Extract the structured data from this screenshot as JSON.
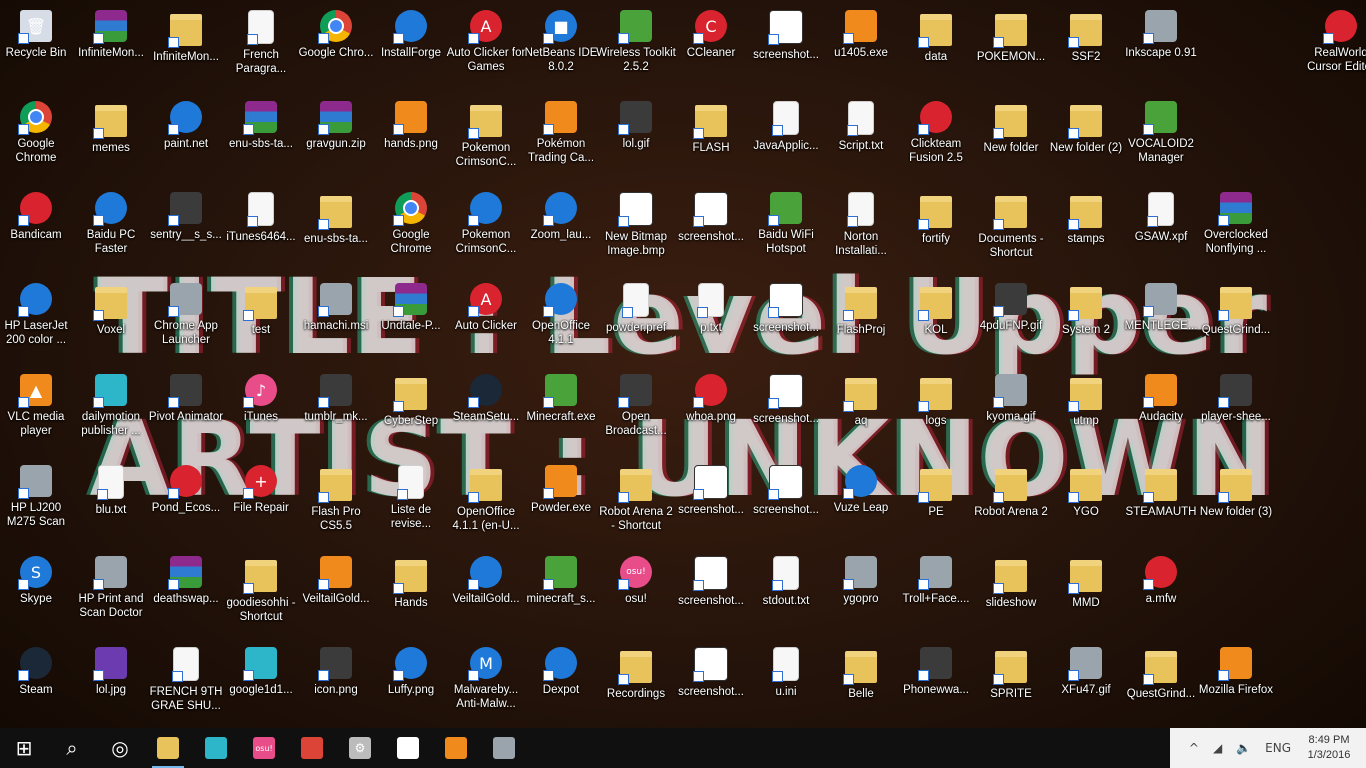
{
  "wallpaper": {
    "line1": "TITLE : Level Upper",
    "line2": "ARTIST : UNKNOWN"
  },
  "icons": [
    {
      "label": "Recycle Bin",
      "type": "bin",
      "glyph": "🗑",
      "col": 0,
      "row": 0
    },
    {
      "label": "InfiniteMon...",
      "type": "rar",
      "glyph": "",
      "col": 1,
      "row": 0
    },
    {
      "label": "InfiniteMon...",
      "type": "folder",
      "glyph": "",
      "col": 2,
      "row": 0
    },
    {
      "label": "French Paragra...",
      "type": "file",
      "glyph": "",
      "col": 3,
      "row": 0
    },
    {
      "label": "Google Chro...",
      "type": "chrome",
      "glyph": "",
      "col": 4,
      "row": 0
    },
    {
      "label": "InstallForge",
      "type": "blue",
      "glyph": "",
      "col": 5,
      "row": 0
    },
    {
      "label": "Auto Clicker for Games",
      "type": "red",
      "glyph": "A",
      "col": 6,
      "row": 0
    },
    {
      "label": "NetBeans IDE 8.0.2",
      "type": "blue",
      "glyph": "■",
      "col": 7,
      "row": 0
    },
    {
      "label": "Wireless Toolkit 2.5.2",
      "type": "green",
      "glyph": "",
      "col": 8,
      "row": 0
    },
    {
      "label": "CCleaner",
      "type": "red",
      "glyph": "C",
      "col": 9,
      "row": 0
    },
    {
      "label": "screenshot...",
      "type": "screen",
      "glyph": "",
      "col": 10,
      "row": 0
    },
    {
      "label": "u1405.exe",
      "type": "orange",
      "glyph": "",
      "col": 11,
      "row": 0
    },
    {
      "label": "data",
      "type": "folder",
      "glyph": "",
      "col": 12,
      "row": 0
    },
    {
      "label": "POKEMON...",
      "type": "folder",
      "glyph": "",
      "col": 13,
      "row": 0
    },
    {
      "label": "SSF2",
      "type": "folder",
      "glyph": "",
      "col": 14,
      "row": 0
    },
    {
      "label": "Inkscape 0.91",
      "type": "gray",
      "glyph": "",
      "col": 15,
      "row": 0
    },
    {
      "label": "RealWorld Cursor Editor",
      "type": "red",
      "glyph": "",
      "col": 17.4,
      "row": 0
    },
    {
      "label": "Google Chrome",
      "type": "chrome",
      "glyph": "",
      "col": 0,
      "row": 1
    },
    {
      "label": "memes",
      "type": "folder",
      "glyph": "",
      "col": 1,
      "row": 1
    },
    {
      "label": "paint.net",
      "type": "blue",
      "glyph": "",
      "col": 2,
      "row": 1
    },
    {
      "label": "enu-sbs-ta...",
      "type": "rar",
      "glyph": "",
      "col": 3,
      "row": 1
    },
    {
      "label": "gravgun.zip",
      "type": "rar",
      "glyph": "",
      "col": 4,
      "row": 1
    },
    {
      "label": "hands.png",
      "type": "orange",
      "glyph": "",
      "col": 5,
      "row": 1
    },
    {
      "label": "Pokemon CrimsonC...",
      "type": "folder",
      "glyph": "",
      "col": 6,
      "row": 1
    },
    {
      "label": "Pokémon Trading Ca...",
      "type": "orange",
      "glyph": "",
      "col": 7,
      "row": 1
    },
    {
      "label": "lol.gif",
      "type": "dark",
      "glyph": "",
      "col": 8,
      "row": 1
    },
    {
      "label": "FLASH",
      "type": "folder",
      "glyph": "",
      "col": 9,
      "row": 1
    },
    {
      "label": "JavaApplic...",
      "type": "file",
      "glyph": "",
      "col": 10,
      "row": 1
    },
    {
      "label": "Script.txt",
      "type": "file",
      "glyph": "",
      "col": 11,
      "row": 1
    },
    {
      "label": "Clickteam Fusion 2.5",
      "type": "red",
      "glyph": "",
      "col": 12,
      "row": 1
    },
    {
      "label": "New folder",
      "type": "folder",
      "glyph": "",
      "col": 13,
      "row": 1
    },
    {
      "label": "New folder (2)",
      "type": "folder",
      "glyph": "",
      "col": 14,
      "row": 1
    },
    {
      "label": "VOCALOID2 Manager",
      "type": "green",
      "glyph": "",
      "col": 15,
      "row": 1
    },
    {
      "label": "Bandicam",
      "type": "red",
      "glyph": "",
      "col": 0,
      "row": 2
    },
    {
      "label": "Baidu PC Faster",
      "type": "blue",
      "glyph": "",
      "col": 1,
      "row": 2
    },
    {
      "label": "sentry__s_s...",
      "type": "dark",
      "glyph": "",
      "col": 2,
      "row": 2
    },
    {
      "label": "iTunes6464...",
      "type": "file",
      "glyph": "",
      "col": 3,
      "row": 2
    },
    {
      "label": "enu-sbs-ta...",
      "type": "folder",
      "glyph": "",
      "col": 4,
      "row": 2
    },
    {
      "label": "Google Chrome",
      "type": "chrome",
      "glyph": "",
      "col": 5,
      "row": 2
    },
    {
      "label": "Pokemon CrimsonC...",
      "type": "blue",
      "glyph": "",
      "col": 6,
      "row": 2
    },
    {
      "label": "Zoom_lau...",
      "type": "blue",
      "glyph": "",
      "col": 7,
      "row": 2
    },
    {
      "label": "New Bitmap Image.bmp",
      "type": "screen",
      "glyph": "",
      "col": 8,
      "row": 2
    },
    {
      "label": "screenshot...",
      "type": "screen",
      "glyph": "",
      "col": 9,
      "row": 2
    },
    {
      "label": "Baidu WiFi Hotspot",
      "type": "green",
      "glyph": "",
      "col": 10,
      "row": 2
    },
    {
      "label": "Norton Installati...",
      "type": "file",
      "glyph": "",
      "col": 11,
      "row": 2
    },
    {
      "label": "fortify",
      "type": "folder",
      "glyph": "",
      "col": 12,
      "row": 2
    },
    {
      "label": "Documents - Shortcut",
      "type": "folder",
      "glyph": "",
      "col": 13,
      "row": 2
    },
    {
      "label": "stamps",
      "type": "folder",
      "glyph": "",
      "col": 14,
      "row": 2
    },
    {
      "label": "GSAW.xpf",
      "type": "file",
      "glyph": "",
      "col": 15,
      "row": 2
    },
    {
      "label": "Overclocked Nonflying ...",
      "type": "rar",
      "glyph": "",
      "col": 16,
      "row": 2
    },
    {
      "label": "HP LaserJet 200 color ...",
      "type": "blue",
      "glyph": "",
      "col": 0,
      "row": 3
    },
    {
      "label": "Voxel",
      "type": "folder",
      "glyph": "",
      "col": 1,
      "row": 3
    },
    {
      "label": "Chrome App Launcher",
      "type": "gray",
      "glyph": "",
      "col": 2,
      "row": 3
    },
    {
      "label": "test",
      "type": "folder",
      "glyph": "",
      "col": 3,
      "row": 3
    },
    {
      "label": "hamachi.msi",
      "type": "gray",
      "glyph": "",
      "col": 4,
      "row": 3
    },
    {
      "label": "Undtale-P...",
      "type": "rar",
      "glyph": "",
      "col": 5,
      "row": 3
    },
    {
      "label": "Auto Clicker",
      "type": "red",
      "glyph": "A",
      "col": 6,
      "row": 3
    },
    {
      "label": "OpenOffice 4.1.1",
      "type": "blue",
      "glyph": "",
      "col": 7,
      "row": 3
    },
    {
      "label": "powder.pref",
      "type": "file",
      "glyph": "",
      "col": 8,
      "row": 3
    },
    {
      "label": "p.txt",
      "type": "file",
      "glyph": "",
      "col": 9,
      "row": 3
    },
    {
      "label": "screenshot...",
      "type": "screen",
      "glyph": "",
      "col": 10,
      "row": 3
    },
    {
      "label": "FlashProj",
      "type": "folder",
      "glyph": "",
      "col": 11,
      "row": 3
    },
    {
      "label": "KOL",
      "type": "folder",
      "glyph": "",
      "col": 12,
      "row": 3
    },
    {
      "label": "4pduFNP.gif",
      "type": "dark",
      "glyph": "",
      "col": 13,
      "row": 3
    },
    {
      "label": "System 2",
      "type": "folder",
      "glyph": "",
      "col": 14,
      "row": 3
    },
    {
      "label": "MENTLEGE...",
      "type": "gray",
      "glyph": "",
      "col": 15,
      "row": 3
    },
    {
      "label": "QuestGrind...",
      "type": "folder",
      "glyph": "",
      "col": 16,
      "row": 3
    },
    {
      "label": "VLC media player",
      "type": "orange",
      "glyph": "▲",
      "col": 0,
      "row": 4
    },
    {
      "label": "dailymotion publisher ...",
      "type": "teal",
      "glyph": "",
      "col": 1,
      "row": 4
    },
    {
      "label": "Pivot Animator",
      "type": "dark",
      "glyph": "",
      "col": 2,
      "row": 4
    },
    {
      "label": "iTunes",
      "type": "pink",
      "glyph": "♪",
      "col": 3,
      "row": 4
    },
    {
      "label": "tumblr_mk...",
      "type": "dark",
      "glyph": "",
      "col": 4,
      "row": 4
    },
    {
      "label": "CyberStep",
      "type": "folder",
      "glyph": "",
      "col": 5,
      "row": 4
    },
    {
      "label": "SteamSetu...",
      "type": "steam",
      "glyph": "",
      "col": 6,
      "row": 4
    },
    {
      "label": "Minecraft.exe",
      "type": "green",
      "glyph": "",
      "col": 7,
      "row": 4
    },
    {
      "label": "Open Broadcast...",
      "type": "dark",
      "glyph": "",
      "col": 8,
      "row": 4
    },
    {
      "label": "whoa.png",
      "type": "red",
      "glyph": "",
      "col": 9,
      "row": 4
    },
    {
      "label": "screenshot...",
      "type": "screen",
      "glyph": "",
      "col": 10,
      "row": 4
    },
    {
      "label": "aq",
      "type": "folder",
      "glyph": "",
      "col": 11,
      "row": 4
    },
    {
      "label": "logs",
      "type": "folder",
      "glyph": "",
      "col": 12,
      "row": 4
    },
    {
      "label": "kyoma.gif",
      "type": "gray",
      "glyph": "",
      "col": 13,
      "row": 4
    },
    {
      "label": "utmp",
      "type": "folder",
      "glyph": "",
      "col": 14,
      "row": 4
    },
    {
      "label": "Audacity",
      "type": "orange",
      "glyph": "",
      "col": 15,
      "row": 4
    },
    {
      "label": "player-shee...",
      "type": "dark",
      "glyph": "",
      "col": 16,
      "row": 4
    },
    {
      "label": "HP LJ200 M275 Scan",
      "type": "gray",
      "glyph": "",
      "col": 0,
      "row": 5
    },
    {
      "label": "blu.txt",
      "type": "file",
      "glyph": "",
      "col": 1,
      "row": 5
    },
    {
      "label": "Pond_Ecos...",
      "type": "red",
      "glyph": "",
      "col": 2,
      "row": 5
    },
    {
      "label": "File Repair",
      "type": "red",
      "glyph": "+",
      "col": 3,
      "row": 5
    },
    {
      "label": "Flash Pro CS5.5",
      "type": "folder",
      "glyph": "",
      "col": 4,
      "row": 5
    },
    {
      "label": "Liste de revise...",
      "type": "file",
      "glyph": "",
      "col": 5,
      "row": 5
    },
    {
      "label": "OpenOffice 4.1.1 (en-U...",
      "type": "folder",
      "glyph": "",
      "col": 6,
      "row": 5
    },
    {
      "label": "Powder.exe",
      "type": "orange",
      "glyph": "",
      "col": 7,
      "row": 5
    },
    {
      "label": "Robot Arena 2 - Shortcut",
      "type": "folder",
      "glyph": "",
      "col": 8,
      "row": 5
    },
    {
      "label": "screenshot...",
      "type": "screen",
      "glyph": "",
      "col": 9,
      "row": 5
    },
    {
      "label": "screenshot...",
      "type": "screen",
      "glyph": "",
      "col": 10,
      "row": 5
    },
    {
      "label": "Vuze Leap",
      "type": "blue",
      "glyph": "",
      "col": 11,
      "row": 5
    },
    {
      "label": "PE",
      "type": "folder",
      "glyph": "",
      "col": 12,
      "row": 5
    },
    {
      "label": "Robot Arena 2",
      "type": "folder",
      "glyph": "",
      "col": 13,
      "row": 5
    },
    {
      "label": "YGO",
      "type": "folder",
      "glyph": "",
      "col": 14,
      "row": 5
    },
    {
      "label": "STEAMAUTH",
      "type": "folder",
      "glyph": "",
      "col": 15,
      "row": 5
    },
    {
      "label": "New folder (3)",
      "type": "folder",
      "glyph": "",
      "col": 16,
      "row": 5
    },
    {
      "label": "Skype",
      "type": "blue",
      "glyph": "S",
      "col": 0,
      "row": 6
    },
    {
      "label": "HP Print and Scan Doctor",
      "type": "gray",
      "glyph": "",
      "col": 1,
      "row": 6
    },
    {
      "label": "deathswap...",
      "type": "rar",
      "glyph": "",
      "col": 2,
      "row": 6
    },
    {
      "label": "goodiesohhi - Shortcut",
      "type": "folder",
      "glyph": "",
      "col": 3,
      "row": 6
    },
    {
      "label": "VeiltailGold...",
      "type": "orange",
      "glyph": "",
      "col": 4,
      "row": 6
    },
    {
      "label": "Hands",
      "type": "folder",
      "glyph": "",
      "col": 5,
      "row": 6
    },
    {
      "label": "VeiltailGold...",
      "type": "blue",
      "glyph": "",
      "col": 6,
      "row": 6
    },
    {
      "label": "minecraft_s...",
      "type": "green",
      "glyph": "",
      "col": 7,
      "row": 6
    },
    {
      "label": "osu!",
      "type": "pink",
      "glyph": "osu!",
      "col": 8,
      "row": 6
    },
    {
      "label": "screenshot...",
      "type": "screen",
      "glyph": "",
      "col": 9,
      "row": 6
    },
    {
      "label": "stdout.txt",
      "type": "file",
      "glyph": "",
      "col": 10,
      "row": 6
    },
    {
      "label": "ygopro",
      "type": "gray",
      "glyph": "",
      "col": 11,
      "row": 6
    },
    {
      "label": "Troll+Face....",
      "type": "gray",
      "glyph": "",
      "col": 12,
      "row": 6
    },
    {
      "label": "slideshow",
      "type": "folder",
      "glyph": "",
      "col": 13,
      "row": 6
    },
    {
      "label": "MMD",
      "type": "folder",
      "glyph": "",
      "col": 14,
      "row": 6
    },
    {
      "label": "a.mfw",
      "type": "red",
      "glyph": "",
      "col": 15,
      "row": 6
    },
    {
      "label": "Steam",
      "type": "steam",
      "glyph": "",
      "col": 0,
      "row": 7
    },
    {
      "label": "lol.jpg",
      "type": "purple",
      "glyph": "",
      "col": 1,
      "row": 7
    },
    {
      "label": "FRENCH 9TH GRAE SHU...",
      "type": "file",
      "glyph": "",
      "col": 2,
      "row": 7
    },
    {
      "label": "google1d1...",
      "type": "teal",
      "glyph": "",
      "col": 3,
      "row": 7
    },
    {
      "label": "icon.png",
      "type": "dark",
      "glyph": "",
      "col": 4,
      "row": 7
    },
    {
      "label": "Luffy.png",
      "type": "blue",
      "glyph": "",
      "col": 5,
      "row": 7
    },
    {
      "label": "Malwareby... Anti-Malw...",
      "type": "blue",
      "glyph": "M",
      "col": 6,
      "row": 7
    },
    {
      "label": "Dexpot",
      "type": "blue",
      "glyph": "",
      "col": 7,
      "row": 7
    },
    {
      "label": "Recordings",
      "type": "folder",
      "glyph": "",
      "col": 8,
      "row": 7
    },
    {
      "label": "screenshot...",
      "type": "screen",
      "glyph": "",
      "col": 9,
      "row": 7
    },
    {
      "label": "u.ini",
      "type": "file",
      "glyph": "",
      "col": 10,
      "row": 7
    },
    {
      "label": "Belle",
      "type": "folder",
      "glyph": "",
      "col": 11,
      "row": 7
    },
    {
      "label": "Phonewwa...",
      "type": "dark",
      "glyph": "",
      "col": 12,
      "row": 7
    },
    {
      "label": "SPRITE",
      "type": "folder",
      "glyph": "",
      "col": 13,
      "row": 7
    },
    {
      "label": "XFu47.gif",
      "type": "gray",
      "glyph": "",
      "col": 14,
      "row": 7
    },
    {
      "label": "QuestGrind...",
      "type": "folder",
      "glyph": "",
      "col": 15,
      "row": 7
    },
    {
      "label": "Mozilla Firefox",
      "type": "orange",
      "glyph": "",
      "col": 16,
      "row": 7
    }
  ],
  "taskbar": {
    "items": [
      {
        "name": "start-button",
        "glyph": "⊞",
        "color": "#ffffff",
        "active": false
      },
      {
        "name": "search-button",
        "glyph": "⌕",
        "color": "#ffffff",
        "active": false
      },
      {
        "name": "obs-taskbar",
        "glyph": "◎",
        "color": "#ffffff",
        "active": false
      },
      {
        "name": "file-explorer-taskbar",
        "glyph": "",
        "color": "#e8c25a",
        "active": true
      },
      {
        "name": "vocaloid-taskbar",
        "glyph": "",
        "color": "#2db6c9",
        "active": false
      },
      {
        "name": "osu-taskbar",
        "glyph": "osu!",
        "color": "#e84d8a",
        "active": false
      },
      {
        "name": "chrome-taskbar",
        "glyph": "",
        "color": "#db4437",
        "active": false
      },
      {
        "name": "settings-taskbar",
        "glyph": "⚙",
        "color": "#bbbbbb",
        "active": false
      },
      {
        "name": "screenshot-taskbar",
        "glyph": "",
        "color": "#ffffff",
        "active": false
      },
      {
        "name": "firefox-taskbar",
        "glyph": "",
        "color": "#f08a1d",
        "active": false
      },
      {
        "name": "hp-taskbar",
        "glyph": "",
        "color": "#9aa4ad",
        "active": false
      }
    ],
    "tray": {
      "chevron": "^",
      "network": "◢",
      "volume": "🔈",
      "language": "ENG",
      "time": "8:49 PM",
      "date": "1/3/2016"
    }
  }
}
